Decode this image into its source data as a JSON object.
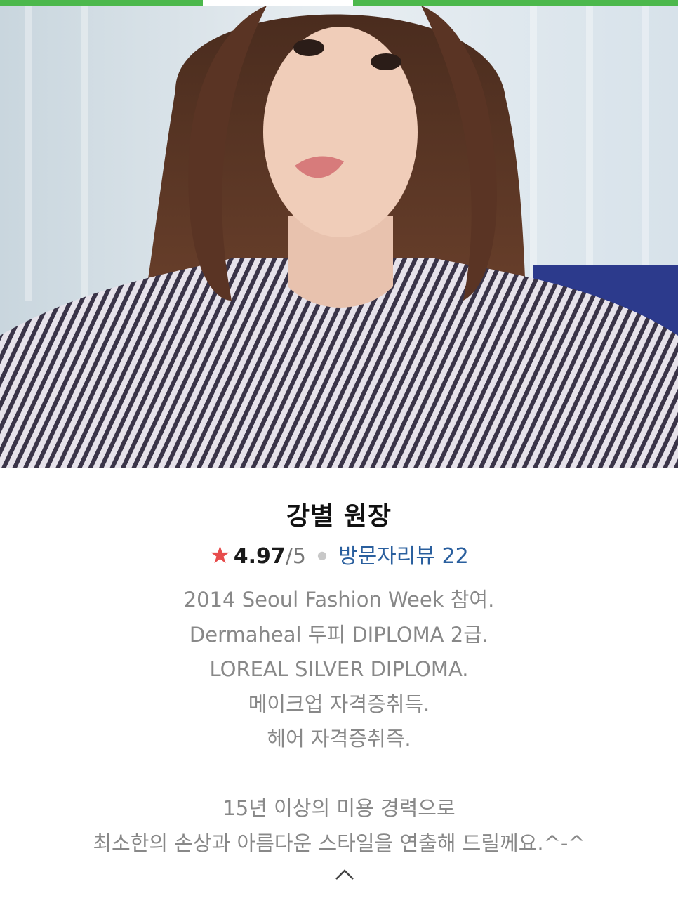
{
  "designer": {
    "name": "강별 원장",
    "rating": "4.97",
    "rating_max": "/5",
    "reviews_label": "방문자리뷰 22",
    "bio_lines_1": [
      "2014 Seoul Fashion Week 참여.",
      "Dermaheal 두피 DIPLOMA 2급.",
      "LOREAL SILVER DIPLOMA.",
      "메이크업 자격증취득.",
      "헤어 자격증취즉."
    ],
    "bio_lines_2": [
      "15년 이상의 미용 경력으로",
      "최소한의 손상과 아름다운 스타일을 연출해 드릴께요.^-^"
    ]
  },
  "icons": {
    "rating": "star-icon",
    "collapse": "chevron-up-icon",
    "separator": "dot-separator"
  },
  "colors": {
    "accent": "#4cb84c",
    "star": "#e74c4c",
    "link": "#2a5f9e",
    "bio_text": "#888888"
  }
}
